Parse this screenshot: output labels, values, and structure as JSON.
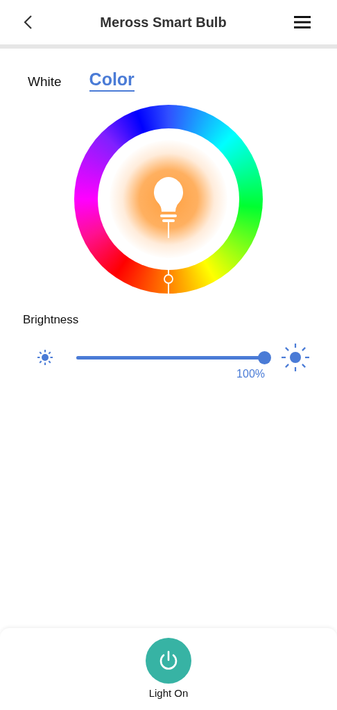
{
  "header": {
    "title": "Meross Smart Bulb"
  },
  "tabs": [
    {
      "label": "White",
      "selected": false
    },
    {
      "label": "Color",
      "selected": true
    }
  ],
  "brightness": {
    "label": "Brightness",
    "level": 1.0,
    "reading": "100%"
  },
  "power": {
    "label": "Light On",
    "on": true
  }
}
